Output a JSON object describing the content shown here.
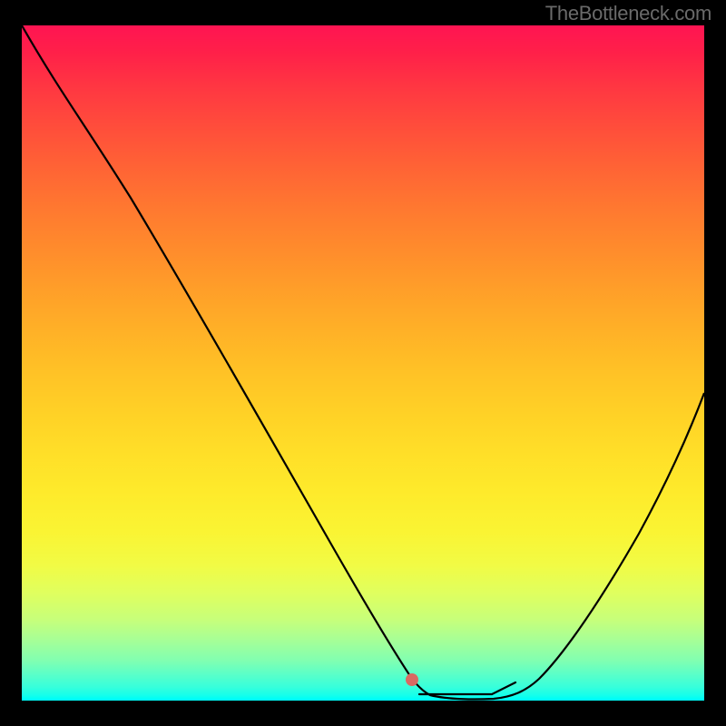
{
  "watermark": "TheBottleneck.com",
  "chart_data": {
    "type": "line",
    "title": "",
    "xlabel": "",
    "ylabel": "",
    "xlim": [
      0,
      100
    ],
    "ylim": [
      0,
      100
    ],
    "grid": false,
    "series": [
      {
        "name": "bottleneck-curve",
        "x": [
          0,
          5,
          10,
          15,
          20,
          25,
          30,
          35,
          40,
          45,
          50,
          55,
          58,
          60,
          62,
          65,
          68,
          70,
          72,
          75,
          80,
          85,
          90,
          95,
          100
        ],
        "values": [
          100,
          93,
          85,
          77,
          69,
          61,
          53,
          45,
          37,
          29,
          21,
          13,
          8,
          5,
          3,
          1,
          0,
          0,
          0,
          1,
          5,
          13,
          23,
          35,
          48
        ]
      }
    ],
    "markers": {
      "dot": {
        "x": 58,
        "y": 2.5
      },
      "segment": [
        {
          "x": 58,
          "y": 0.7
        },
        {
          "x": 68,
          "y": 0.7
        },
        {
          "x": 72,
          "y": 2.2
        }
      ]
    },
    "gradient": {
      "top": "#ff1452",
      "mid": "#ffd026",
      "bottom": "#00fffe"
    }
  }
}
